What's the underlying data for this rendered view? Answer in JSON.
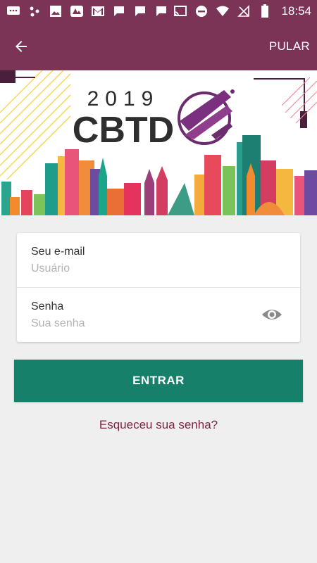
{
  "status_bar": {
    "time": "18:54",
    "icons": [
      "messages-icon",
      "dots-icon",
      "image-icon",
      "app-icon",
      "gmail-icon",
      "chat-icon",
      "chat-icon",
      "chat-icon",
      "cast-icon",
      "do-not-disturb-icon",
      "wifi-icon",
      "no-signal-icon",
      "battery-icon"
    ]
  },
  "app_bar": {
    "back_icon": "arrow-left-icon",
    "skip_label": "PULAR",
    "color": "#7b3356"
  },
  "banner": {
    "year": "2019",
    "logo_text": "CBTD"
  },
  "login": {
    "email_label": "Seu e-mail",
    "email_placeholder": "Usuário",
    "email_value": "",
    "password_label": "Senha",
    "password_placeholder": "Sua senha",
    "password_value": "",
    "visibility_icon": "eye-icon"
  },
  "enter_button": {
    "label": "ENTRAR",
    "color": "#17806a"
  },
  "forgot_link": {
    "label": "Esqueceu sua senha?",
    "color": "#7b2443"
  }
}
